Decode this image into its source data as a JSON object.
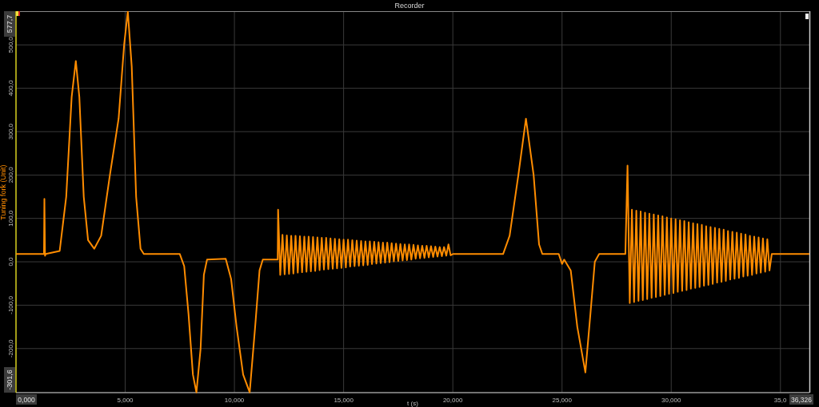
{
  "window": {
    "title": "Recorder"
  },
  "chart": {
    "range_labels": {
      "y_max": "577,7",
      "y_min": "-301,6",
      "x_min": "0,000",
      "x_max": "36,326"
    },
    "chart_data": {
      "type": "line",
      "xlabel": "t (s)",
      "ylabel": "Tuning fork (Unit)",
      "grid": true,
      "xlim": [
        0,
        36.326
      ],
      "ylim": [
        -301.6,
        577.7
      ],
      "xticks": [
        {
          "value": 5,
          "label": "5,000"
        },
        {
          "value": 10,
          "label": "10,000"
        },
        {
          "value": 15,
          "label": "15,000"
        },
        {
          "value": 20,
          "label": "20,000"
        },
        {
          "value": 25,
          "label": "25,000"
        },
        {
          "value": 30,
          "label": "30,000"
        },
        {
          "value": 35,
          "label": "35,0"
        }
      ],
      "yticks": [
        {
          "value": -200,
          "label": "-200,0"
        },
        {
          "value": -100,
          "label": "-100,0"
        },
        {
          "value": 0,
          "label": "0,0"
        },
        {
          "value": 100,
          "label": "100,0"
        },
        {
          "value": 200,
          "label": "200,0"
        },
        {
          "value": 300,
          "label": "300,0"
        },
        {
          "value": 400,
          "label": "400,0"
        },
        {
          "value": 500,
          "label": "500,0"
        }
      ],
      "x": [
        0,
        1.28,
        1.3,
        1.33,
        1.36,
        2.0,
        2.3,
        2.55,
        2.74,
        2.9,
        3.1,
        3.3,
        3.58,
        3.9,
        4.3,
        4.7,
        4.95,
        5.12,
        5.3,
        5.5,
        5.7,
        5.85,
        7.5,
        7.7,
        7.9,
        8.1,
        8.26,
        8.45,
        8.6,
        8.75,
        9.6,
        9.85,
        10.1,
        10.4,
        10.7,
        10.95,
        11.15,
        11.3,
        11.98,
        12.0,
        12.1,
        12.2,
        12.3,
        12.4,
        12.5,
        12.6,
        12.7,
        12.8,
        12.9,
        13.0,
        13.1,
        13.2,
        13.3,
        13.4,
        13.5,
        13.6,
        13.7,
        13.8,
        13.9,
        14.0,
        14.1,
        14.2,
        14.3,
        14.4,
        14.5,
        14.6,
        14.7,
        14.8,
        14.9,
        15.0,
        15.1,
        15.2,
        15.3,
        15.4,
        15.5,
        15.6,
        15.7,
        15.8,
        15.9,
        16.0,
        16.1,
        16.2,
        16.3,
        16.4,
        16.5,
        16.6,
        16.7,
        16.8,
        16.9,
        17.0,
        17.1,
        17.2,
        17.3,
        17.4,
        17.5,
        17.6,
        17.7,
        17.8,
        17.9,
        18.0,
        18.1,
        18.2,
        18.3,
        18.4,
        18.5,
        18.6,
        18.7,
        18.8,
        18.9,
        19.0,
        19.1,
        19.2,
        19.3,
        19.4,
        19.5,
        19.6,
        19.7,
        19.8,
        19.9,
        20.0,
        22.3,
        22.6,
        23.0,
        23.35,
        23.7,
        23.95,
        24.1,
        24.85,
        25.0,
        25.1,
        25.4,
        25.7,
        26.07,
        26.3,
        26.5,
        26.7,
        27.9,
        28.0,
        28.1,
        28.2,
        28.3,
        28.4,
        28.5,
        28.6,
        28.7,
        28.8,
        28.9,
        29.0,
        29.1,
        29.2,
        29.3,
        29.4,
        29.5,
        29.6,
        29.7,
        29.8,
        29.9,
        30.0,
        30.1,
        30.2,
        30.3,
        30.4,
        30.5,
        30.6,
        30.7,
        30.8,
        30.9,
        31.0,
        31.1,
        31.2,
        31.3,
        31.4,
        31.5,
        31.6,
        31.7,
        31.8,
        31.9,
        32.0,
        32.1,
        32.2,
        32.3,
        32.4,
        32.5,
        32.6,
        32.7,
        32.8,
        32.9,
        33.0,
        33.1,
        33.2,
        33.3,
        33.4,
        33.5,
        33.6,
        33.7,
        33.8,
        33.9,
        34.0,
        34.1,
        34.2,
        34.3,
        34.4,
        34.5,
        34.6,
        36.326
      ],
      "series": [
        {
          "color": "#ff8c00",
          "values": [
            18,
            18,
            145,
            14,
            18,
            25,
            150,
            380,
            463,
            380,
            150,
            50,
            30,
            60,
            200,
            330,
            500,
            577,
            450,
            150,
            30,
            18,
            18,
            -10,
            -120,
            -260,
            -301,
            -200,
            -30,
            5,
            7,
            -40,
            -150,
            -260,
            -301,
            -150,
            -20,
            5,
            5,
            120,
            -30,
            62,
            -29,
            61,
            -28,
            60,
            -27,
            60,
            -25,
            59,
            -24,
            58,
            -23,
            58,
            -22,
            57,
            -21,
            56,
            -19,
            55,
            -18,
            55,
            -17,
            54,
            -16,
            53,
            -15,
            52,
            -14,
            51,
            -13,
            51,
            -11,
            50,
            -10,
            49,
            -9,
            48,
            -8,
            47,
            -7,
            47,
            -5,
            46,
            -4,
            45,
            -3,
            44,
            -2,
            44,
            -1,
            43,
            1,
            42,
            2,
            41,
            3,
            40,
            4,
            40,
            5,
            39,
            7,
            38,
            8,
            37,
            9,
            37,
            10,
            36,
            11,
            35,
            12,
            34,
            13,
            34,
            14,
            40,
            15,
            18,
            18,
            60,
            200,
            330,
            200,
            40,
            18,
            18,
            -5,
            5,
            -20,
            -150,
            -255,
            -120,
            0,
            18,
            18,
            222,
            -95,
            120,
            -93,
            118,
            -90,
            116,
            -88,
            113,
            -86,
            111,
            -83,
            109,
            -81,
            107,
            -79,
            105,
            -76,
            102,
            -74,
            100,
            -72,
            98,
            -69,
            96,
            -67,
            94,
            -65,
            91,
            -62,
            89,
            -60,
            87,
            -58,
            85,
            -55,
            82,
            -53,
            80,
            -51,
            78,
            -48,
            76,
            -46,
            74,
            -44,
            71,
            -41,
            69,
            -39,
            67,
            -37,
            65,
            -34,
            63,
            -32,
            60,
            -30,
            58,
            -27,
            56,
            -25,
            54,
            -23,
            52,
            -20,
            18,
            18
          ]
        }
      ]
    }
  }
}
